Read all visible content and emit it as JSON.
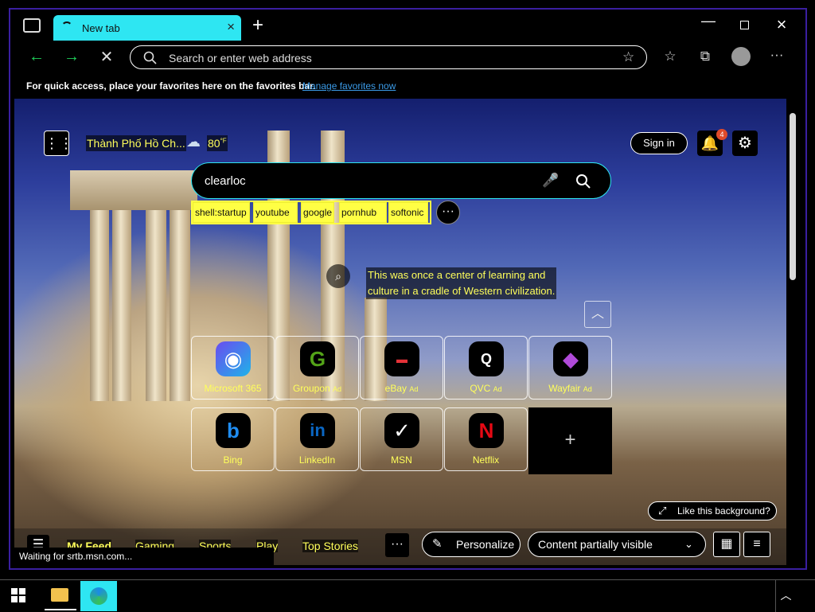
{
  "tab": {
    "title": "New tab"
  },
  "address": {
    "placeholder": "Search or enter web address"
  },
  "favbar": {
    "text": "For quick access, place your favorites here on the favorites bar.",
    "link": "Manage favorites now"
  },
  "ntp": {
    "location": "Thành Phố Hồ Ch...",
    "temperature": "80",
    "unit": "°F",
    "sign_in": "Sign in",
    "notif_count": "4",
    "search_value": "clearloc",
    "suggestions": [
      "shell:startup",
      "youtube",
      "google",
      "pornhub",
      "softonic"
    ],
    "caption_line1": "This was once a center of learning and",
    "caption_line2": "culture in a cradle of Western civilization.",
    "tiles": [
      {
        "label": "Microsoft 365",
        "ad": ""
      },
      {
        "label": "Groupon",
        "ad": "Ad"
      },
      {
        "label": "eBay",
        "ad": "Ad"
      },
      {
        "label": "QVC",
        "ad": "Ad"
      },
      {
        "label": "Wayfair",
        "ad": "Ad"
      },
      {
        "label": "Bing",
        "ad": ""
      },
      {
        "label": "LinkedIn",
        "ad": ""
      },
      {
        "label": "MSN",
        "ad": ""
      },
      {
        "label": "Netflix",
        "ad": ""
      }
    ],
    "like_bg": "Like this background?",
    "feed_tabs": [
      "My Feed",
      "Gaming",
      "Sports",
      "Play",
      "Top Stories"
    ],
    "personalize": "Personalize",
    "content_select": "Content partially visible",
    "status": "Waiting for srtb.msn.com..."
  },
  "colors": {
    "accent": "#2ee6f2",
    "highlight": "#ffff44",
    "window_border": "#3a1fa0"
  }
}
